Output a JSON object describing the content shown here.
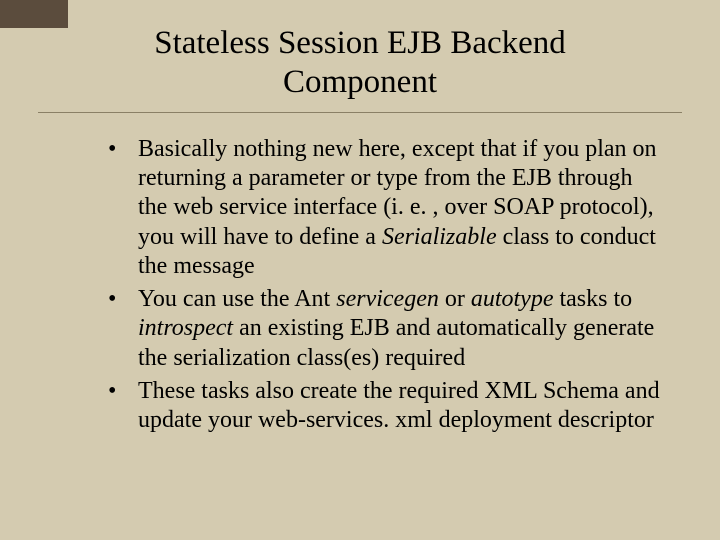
{
  "title": "Stateless Session EJB Backend Component",
  "bullets": [
    {
      "pre": "Basically nothing new here, except that if you plan on returning a parameter or type from the EJB through the web service interface (i. e. , over SOAP protocol), you will have to define a ",
      "em1": "Serializable",
      "mid1": " class to conduct the message",
      "em2": "",
      "mid2": "",
      "em3": "",
      "post": ""
    },
    {
      "pre": "You can use the Ant ",
      "em1": "servicegen",
      "mid1": " or ",
      "em2": "autotype",
      "mid2": " tasks to ",
      "em3": "introspect",
      "post": " an existing EJB and automatically generate the serialization class(es) required"
    },
    {
      "pre": "These tasks also create the required XML Schema and update your web-services. xml deployment descriptor",
      "em1": "",
      "mid1": "",
      "em2": "",
      "mid2": "",
      "em3": "",
      "post": ""
    }
  ]
}
